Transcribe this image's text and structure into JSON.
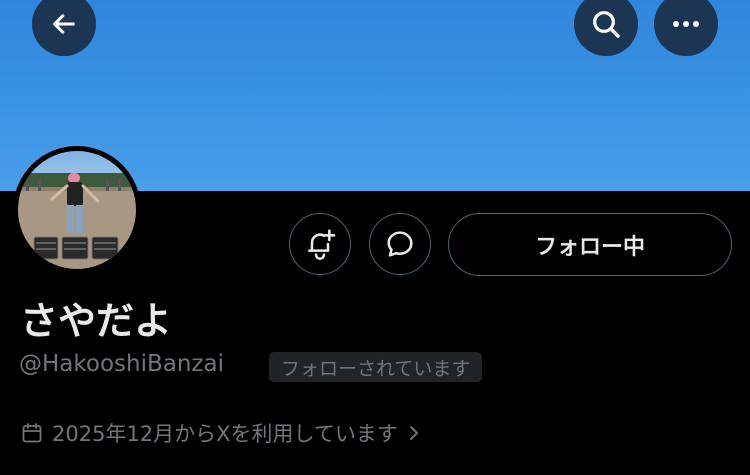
{
  "header": {
    "back_icon": "arrow-left-icon",
    "search_icon": "search-icon",
    "more_icon": "more-horizontal-icon"
  },
  "profile": {
    "display_name": "さやだよ",
    "handle": "@HakooshiBanzai",
    "follows_you_badge": "フォローされています",
    "follow_button_label": "フォロー中",
    "joined_text": "2025年12月からXを利用しています",
    "notification_icon": "bell-plus-icon",
    "message_icon": "message-bubble-icon",
    "calendar_icon": "calendar-icon"
  },
  "colors": {
    "banner": "#3b93e3",
    "background": "#000000",
    "primary_text": "#e7e9ea",
    "secondary_text": "#71767b",
    "button_border": "#536471"
  }
}
